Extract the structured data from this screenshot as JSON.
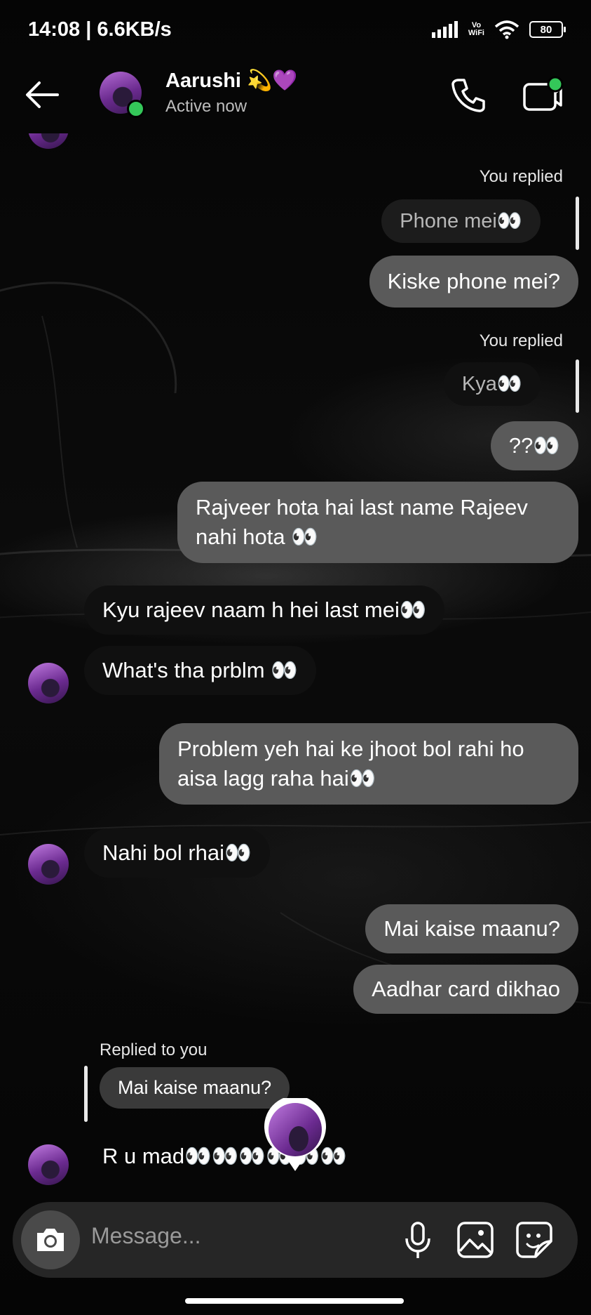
{
  "status_bar": {
    "time": "14:08 | 6.6KB/s",
    "vo": "Vo",
    "wifi_label": "WiFi",
    "battery": "80"
  },
  "header": {
    "contact_name": "Aarushi 💫💜",
    "status": "Active now"
  },
  "messages": {
    "m1": {
      "label": "You replied",
      "quote": "Phone mei👀",
      "text": "Kiske phone mei?"
    },
    "m2": {
      "label": "You replied",
      "quote": "Kya👀",
      "text": "??👀"
    },
    "m3": {
      "text": "Rajveer hota hai last name Rajeev nahi hota 👀"
    },
    "m4": {
      "text": "Kyu rajeev naam h hei last mei👀"
    },
    "m5": {
      "text": "What's tha prblm 👀"
    },
    "m6": {
      "text": "Problem yeh hai ke jhoot bol rahi ho aisa lagg raha hai👀"
    },
    "m7": {
      "text": "Nahi bol rhai👀"
    },
    "m8": {
      "text": "Mai kaise maanu?"
    },
    "m9": {
      "text": "Aadhar card dikhao"
    },
    "m10": {
      "label": "Replied to you",
      "quote": "Mai kaise maanu?",
      "text": "R u mad👀👀👀👀👀👀"
    }
  },
  "composer": {
    "placeholder": "Message..."
  },
  "colors": {
    "outgoing_bubble": "#5a5a5a",
    "incoming_bubble": "#101010",
    "online": "#34c759",
    "background": "#000000"
  }
}
